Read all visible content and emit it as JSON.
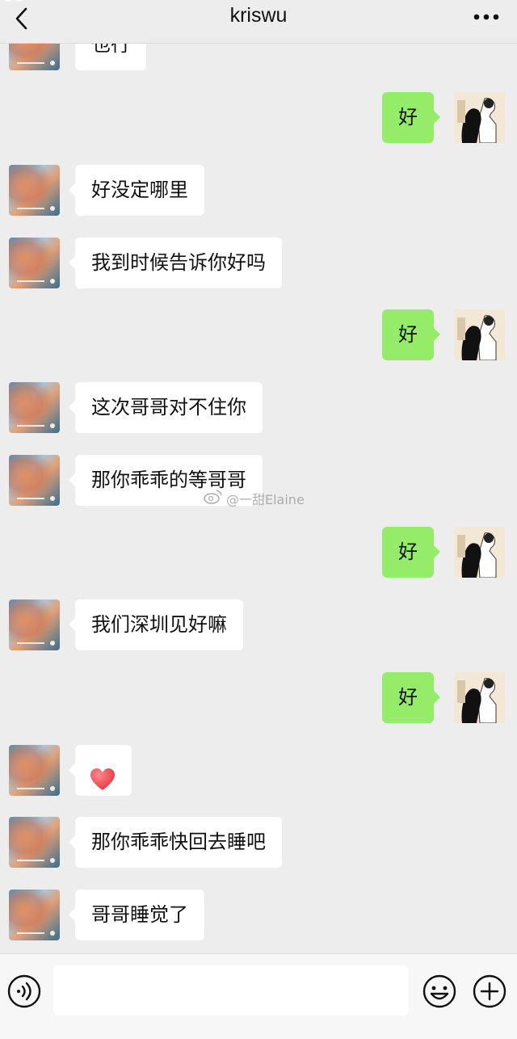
{
  "header": {
    "title": "kriswu",
    "back_icon": "chevron-left-icon",
    "more_icon": "ellipsis-icon"
  },
  "messages": [
    {
      "side": "left",
      "text": "也行",
      "partial": true
    },
    {
      "side": "right",
      "text": "好"
    },
    {
      "side": "left",
      "text": "好没定哪里"
    },
    {
      "side": "left",
      "text": "我到时候告诉你好吗"
    },
    {
      "side": "right",
      "text": "好"
    },
    {
      "side": "left",
      "text": "这次哥哥对不住你"
    },
    {
      "side": "left",
      "text": "那你乖乖的等哥哥"
    },
    {
      "side": "right",
      "text": "好"
    },
    {
      "side": "left",
      "text": "我们深圳见好嘛"
    },
    {
      "side": "right",
      "text": "好"
    },
    {
      "side": "left",
      "text": "",
      "emoji": "heart-icon"
    },
    {
      "side": "left",
      "text": "那你乖乖快回去睡吧"
    },
    {
      "side": "left",
      "text": "哥哥睡觉了"
    }
  ],
  "watermark": {
    "text": "@一甜Elaine",
    "icon": "weibo-icon"
  },
  "input_bar": {
    "voice_icon": "voice-icon",
    "emoji_icon": "emoji-icon",
    "plus_icon": "plus-icon",
    "placeholder": ""
  },
  "colors": {
    "background": "#ededed",
    "bubble_self": "#95ec69",
    "bubble_other": "#ffffff",
    "heart": "#e63946"
  }
}
